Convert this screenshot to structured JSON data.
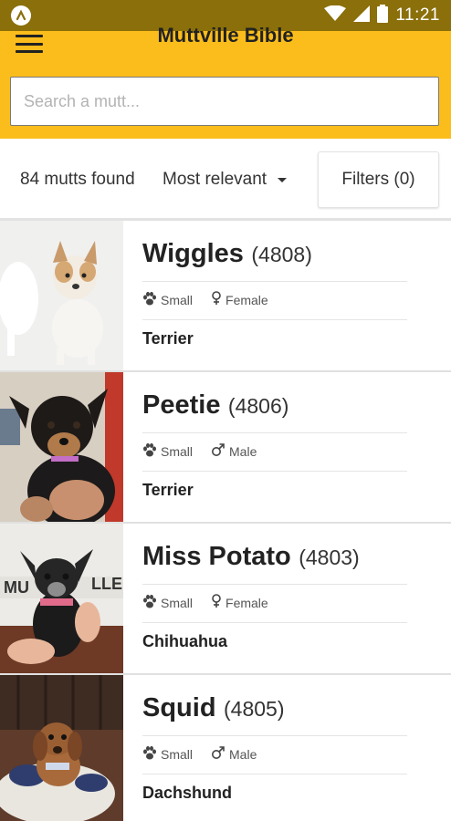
{
  "status_bar": {
    "time": "11:21"
  },
  "app_bar": {
    "title": "Muttville Bible"
  },
  "search": {
    "placeholder": "Search a mutt..."
  },
  "toolbar": {
    "result_count": "84 mutts found",
    "sort_label": "Most relevant",
    "filters_label": "Filters (0)"
  },
  "dogs": [
    {
      "name": "Wiggles",
      "id": "(4808)",
      "size": "Small",
      "sex": "Female",
      "breed": "Terrier"
    },
    {
      "name": "Peetie",
      "id": "(4806)",
      "size": "Small",
      "sex": "Male",
      "breed": "Terrier"
    },
    {
      "name": "Miss Potato",
      "id": "(4803)",
      "size": "Small",
      "sex": "Female",
      "breed": "Chihuahua"
    },
    {
      "name": "Squid",
      "id": "(4805)",
      "size": "Small",
      "sex": "Male",
      "breed": "Dachshund"
    }
  ],
  "colors": {
    "app_bar": "#fbbd1c",
    "status_bar": "#8a6f0a"
  },
  "icons": {
    "menu": "hamburger-menu-icon",
    "size": "paw-icon",
    "female": "female-symbol-icon",
    "male": "male-symbol-icon",
    "sort": "caret-down-icon"
  }
}
